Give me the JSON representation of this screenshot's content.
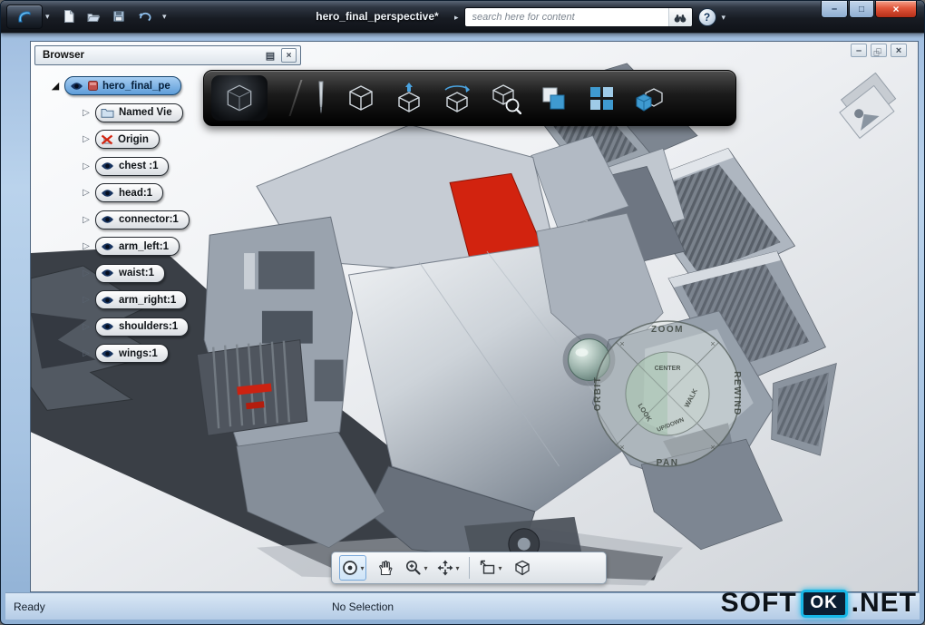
{
  "titlebar": {
    "title": "hero_final_perspective*",
    "search": {
      "placeholder": "search here for content"
    },
    "help_label": "?"
  },
  "browser": {
    "title": "Browser",
    "root": {
      "label": "hero_final_pe"
    },
    "items": [
      {
        "label": "Named Vie"
      },
      {
        "label": "Origin"
      },
      {
        "label": "chest :1"
      },
      {
        "label": "head:1"
      },
      {
        "label": "connector:1"
      },
      {
        "label": "arm_left:1"
      },
      {
        "label": "waist:1"
      },
      {
        "label": "arm_right:1"
      },
      {
        "label": "shoulders:1"
      },
      {
        "label": "wings:1"
      }
    ]
  },
  "wheel": {
    "zoom": "ZOOM",
    "rewind": "REWIND",
    "pan": "PAN",
    "orbit": "ORBIT",
    "center": "CENTER",
    "walk": "WALK",
    "look": "LOOK",
    "updown": "UP/DOWN"
  },
  "status": {
    "ready": "Ready",
    "selection": "No Selection"
  },
  "watermark": {
    "soft": "SOFT",
    "ok": "OK",
    "net": ".NET"
  },
  "icons": {
    "chevron_down": "▾",
    "chevron_right": "▸",
    "expander_collapsed": "▷",
    "expander_expanded": "◢",
    "close": "×",
    "minimize": "–",
    "maximize": "□",
    "browser_menu": "▤"
  },
  "colors": {
    "accent_red": "#d2230f",
    "selection_blue": "#5e9dd9",
    "frame_blue": "#a6c3e2"
  }
}
